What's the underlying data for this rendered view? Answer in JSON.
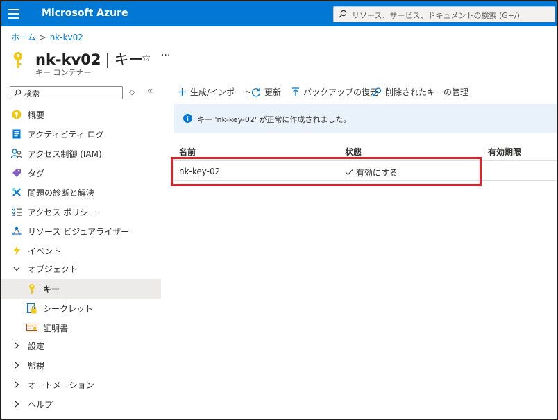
{
  "header": {
    "brand": "Microsoft Azure",
    "search_placeholder": "リソース、サービス、ドキュメントの検索 (G+/)"
  },
  "breadcrumb": {
    "home": "ホーム",
    "current": "nk-kv02"
  },
  "page": {
    "name": "nk-kv02",
    "separator": "|",
    "section": "キー",
    "subtitle": "キー コンテナー",
    "star": "☆",
    "more": "···"
  },
  "sidebar": {
    "search_placeholder": "検索",
    "items": [
      {
        "label": "概要",
        "icon": "overview-icon"
      },
      {
        "label": "アクティビティ ログ",
        "icon": "activity-log-icon"
      },
      {
        "label": "アクセス制御 (IAM)",
        "icon": "iam-icon"
      },
      {
        "label": "タグ",
        "icon": "tag-icon"
      },
      {
        "label": "問題の診断と解決",
        "icon": "diagnose-icon"
      },
      {
        "label": "アクセス ポリシー",
        "icon": "access-policy-icon"
      },
      {
        "label": "リソース ビジュアライザー",
        "icon": "visualizer-icon"
      },
      {
        "label": "イベント",
        "icon": "event-icon"
      },
      {
        "label": "オブジェクト",
        "icon": "chevron-down-icon"
      },
      {
        "label": "キー",
        "icon": "key-icon"
      },
      {
        "label": "シークレット",
        "icon": "secret-icon"
      },
      {
        "label": "証明書",
        "icon": "certificate-icon"
      },
      {
        "label": "設定",
        "icon": "chevron-right-icon"
      },
      {
        "label": "監視",
        "icon": "chevron-right-icon"
      },
      {
        "label": "オートメーション",
        "icon": "chevron-right-icon"
      },
      {
        "label": "ヘルプ",
        "icon": "chevron-right-icon"
      }
    ]
  },
  "toolbar": {
    "generate": "生成/インポート",
    "refresh": "更新",
    "restore": "バックアップの復元",
    "deleted": "削除されたキーの管理"
  },
  "notification": {
    "text": "キー 'nk-key-02' が正常に作成されました。"
  },
  "table": {
    "columns": [
      "名前",
      "状態",
      "有効期限"
    ],
    "rows": [
      {
        "name": "nk-key-02",
        "status": "有効にする",
        "expiry": ""
      }
    ]
  },
  "colors": {
    "accent": "#0078d4",
    "highlight": "#e0202a",
    "banner": "#e9f1fb"
  }
}
